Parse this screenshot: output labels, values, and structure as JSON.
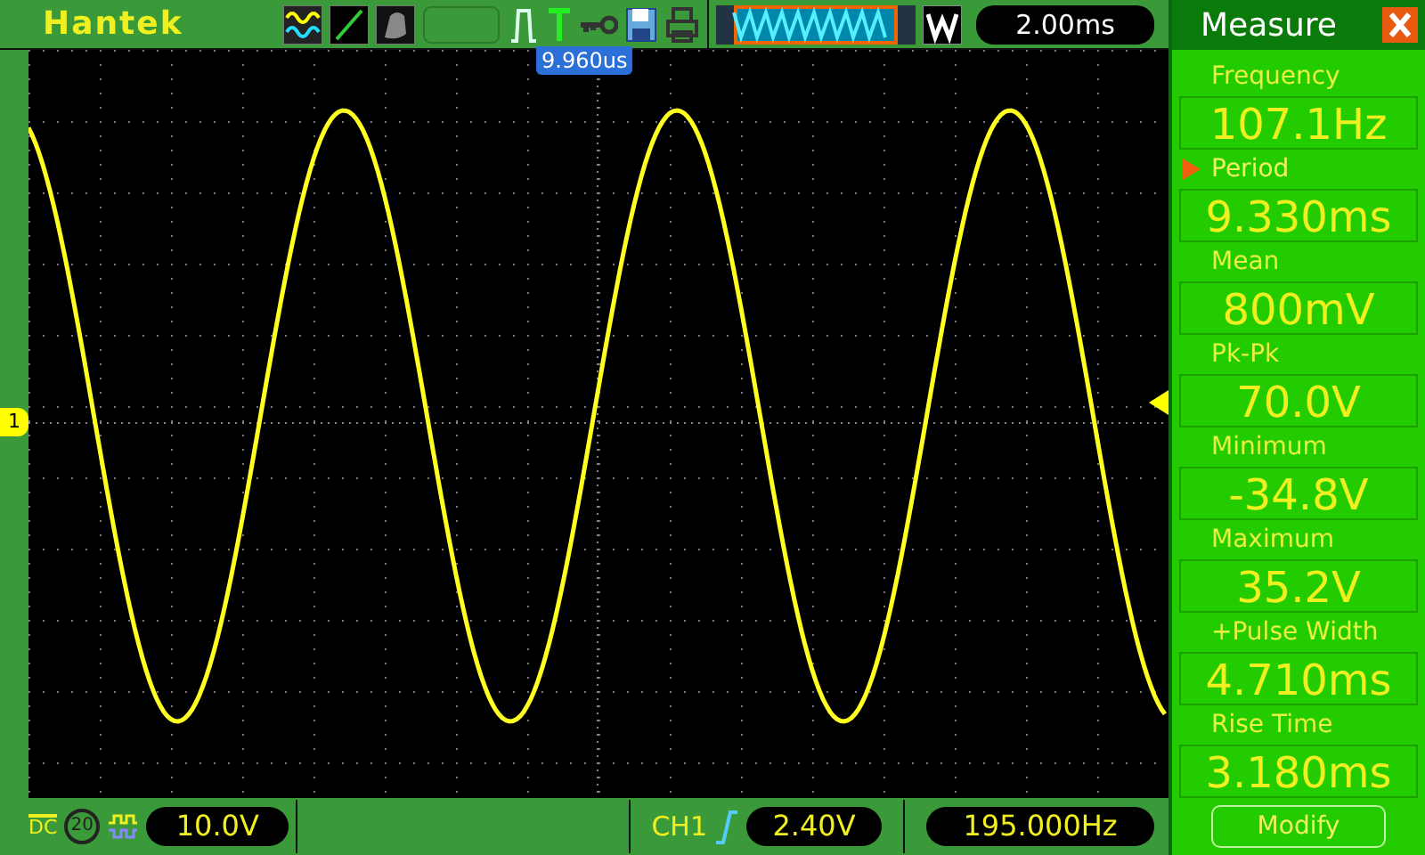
{
  "header": {
    "brand": "Hantek",
    "timebase": "2.00ms"
  },
  "scope": {
    "trigger_position": "9.960us",
    "channel_marker": "1"
  },
  "measure": {
    "title": "Measure",
    "items": [
      {
        "label": "Frequency",
        "value": "107.1Hz",
        "selected": false
      },
      {
        "label": "Period",
        "value": "9.330ms",
        "selected": true
      },
      {
        "label": "Mean",
        "value": "800mV",
        "selected": false
      },
      {
        "label": "Pk-Pk",
        "value": "70.0V",
        "selected": false
      },
      {
        "label": "Minimum",
        "value": "-34.8V",
        "selected": false
      },
      {
        "label": "Maximum",
        "value": "35.2V",
        "selected": false
      },
      {
        "label": "+Pulse Width",
        "value": "4.710ms",
        "selected": false
      },
      {
        "label": "Rise Time",
        "value": "3.180ms",
        "selected": false
      }
    ],
    "button": "Modify"
  },
  "status_bar": {
    "coupling": "DC",
    "bandwidth_limit": "20",
    "volts_per_div": "10.0V",
    "channel": "CH1",
    "trigger_level": "2.40V",
    "trigger_frequency": "195.000Hz"
  }
}
